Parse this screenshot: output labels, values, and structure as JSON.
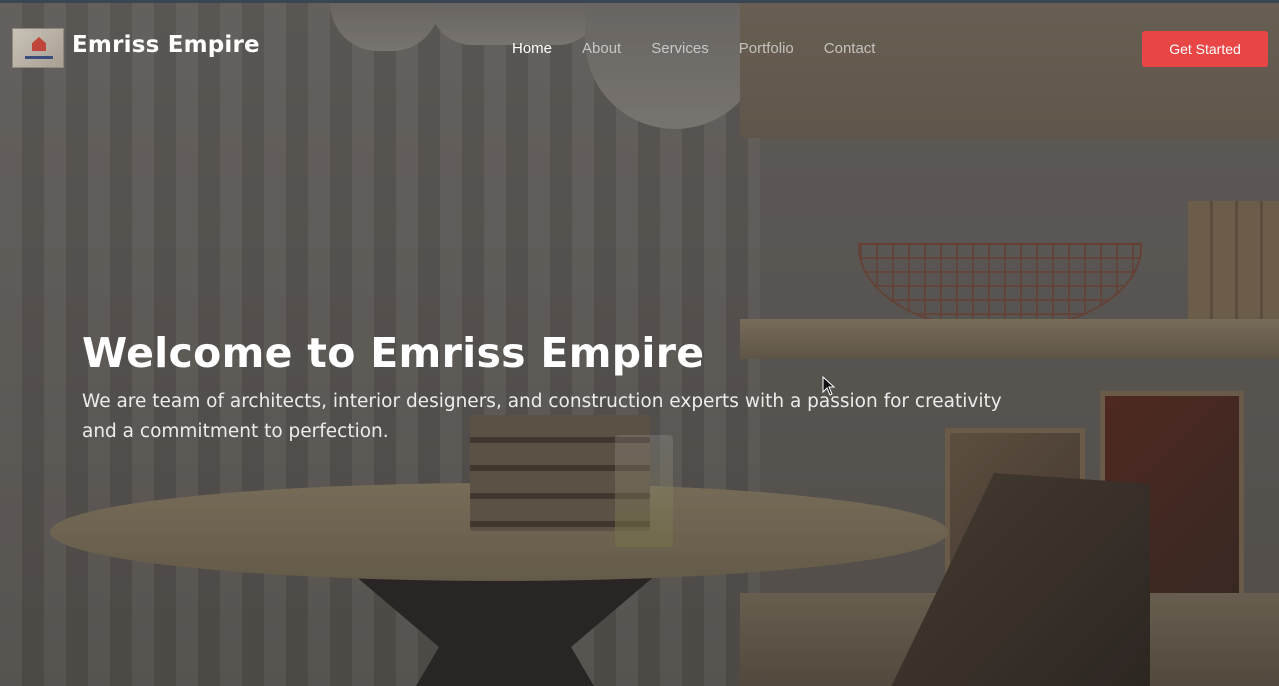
{
  "brand": {
    "name": "Emriss Empire",
    "logo_icon": "emriss-empire-logo"
  },
  "nav": {
    "items": [
      {
        "label": "Home",
        "active": true
      },
      {
        "label": "About",
        "active": false
      },
      {
        "label": "Services",
        "active": false
      },
      {
        "label": "Portfolio",
        "active": false
      },
      {
        "label": "Contact",
        "active": false
      }
    ],
    "cta_label": "Get Started"
  },
  "hero": {
    "title": "Welcome to Emriss Empire",
    "subtitle": "We are team of architects, interior designers, and construction experts with a passion for creativity and a commitment to perfection.",
    "background_icon": "interior-room-photo"
  },
  "colors": {
    "accent": "#e84545",
    "text": "#ffffff",
    "nav_inactive": "rgba(255,255,255,0.62)"
  }
}
